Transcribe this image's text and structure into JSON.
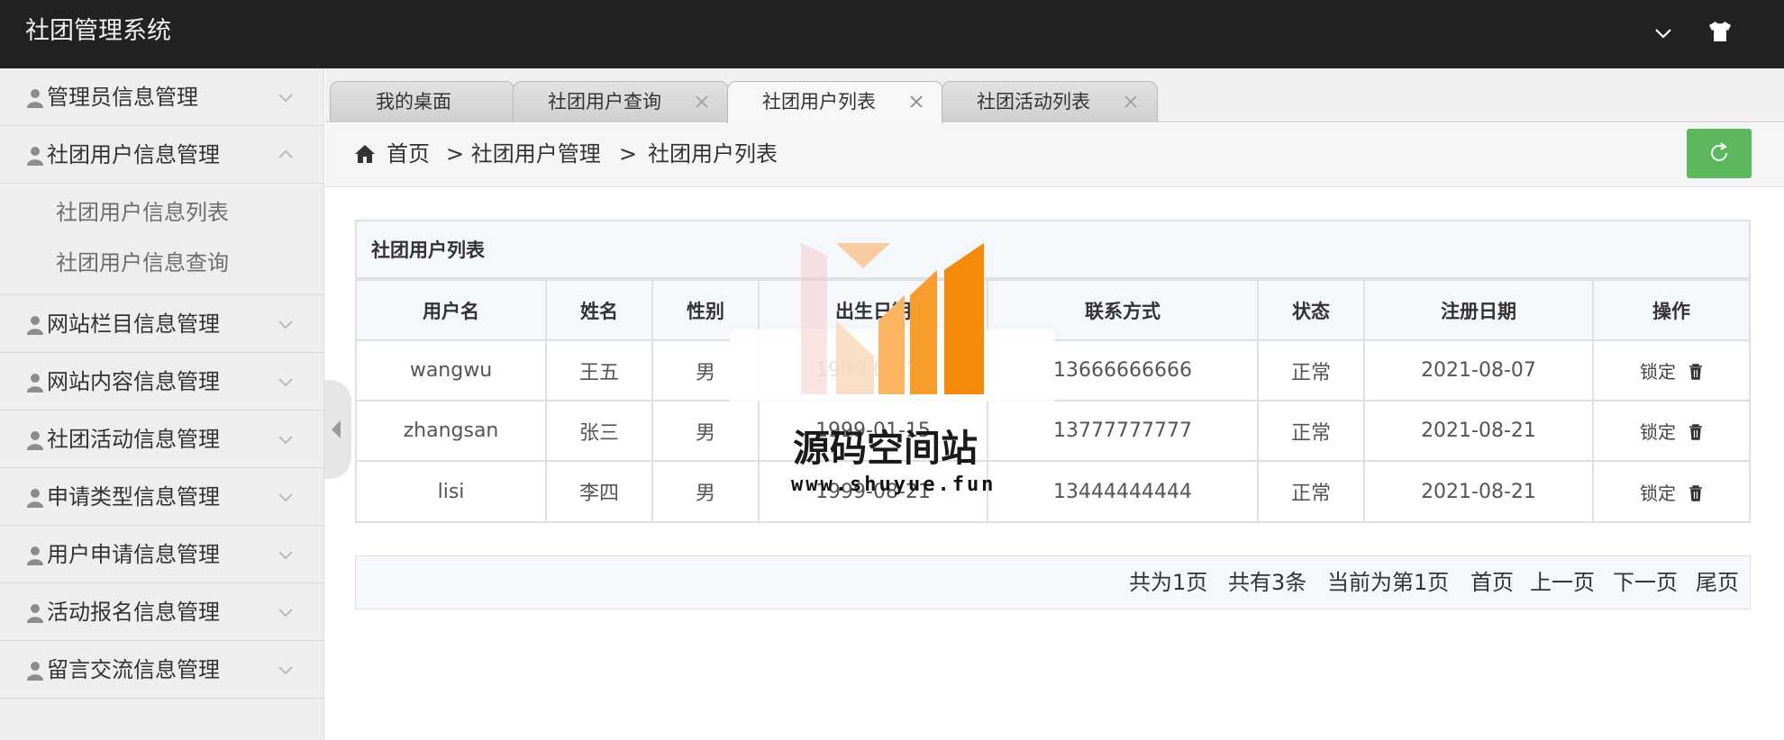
{
  "app": {
    "title": "社团管理系统"
  },
  "header": {
    "dropdown_icon": "chevron-down-icon",
    "theme_icon": "tshirt-icon"
  },
  "sidebar": {
    "items": [
      {
        "label": "管理员信息管理",
        "expanded": false
      },
      {
        "label": "社团用户信息管理",
        "expanded": true,
        "children": [
          "社团用户信息列表",
          "社团用户信息查询"
        ]
      },
      {
        "label": "网站栏目信息管理",
        "expanded": false
      },
      {
        "label": "网站内容信息管理",
        "expanded": false
      },
      {
        "label": "社团活动信息管理",
        "expanded": false
      },
      {
        "label": "申请类型信息管理",
        "expanded": false
      },
      {
        "label": "用户申请信息管理",
        "expanded": false
      },
      {
        "label": "活动报名信息管理",
        "expanded": false
      },
      {
        "label": "留言交流信息管理",
        "expanded": false
      }
    ]
  },
  "tabs": [
    {
      "label": "我的桌面",
      "closable": false,
      "active": false
    },
    {
      "label": "社团用户查询",
      "closable": true,
      "active": false
    },
    {
      "label": "社团用户列表",
      "closable": true,
      "active": true
    },
    {
      "label": "社团活动列表",
      "closable": true,
      "active": false
    }
  ],
  "breadcrumb": {
    "home": "首页",
    "level1": "> 社团用户管理",
    "separator": ">",
    "level2": "社团用户列表"
  },
  "colors": {
    "topbar": "#222222",
    "refresh_button": "#5cb85c",
    "table_header_bg": "#f4f7fc"
  },
  "table": {
    "title": "社团用户列表",
    "columns": [
      "用户名",
      "姓名",
      "性别",
      "出生日期",
      "联系方式",
      "状态",
      "注册日期",
      "操作"
    ],
    "rows": [
      {
        "username": "wangwu",
        "name": "王五",
        "gender": "男",
        "birth": "1999-01-15",
        "phone": "13666666666",
        "status": "正常",
        "reg_date": "2021-08-07",
        "action": "锁定"
      },
      {
        "username": "zhangsan",
        "name": "张三",
        "gender": "男",
        "birth": "1999-01-15",
        "phone": "13777777777",
        "status": "正常",
        "reg_date": "2021-08-21",
        "action": "锁定"
      },
      {
        "username": "lisi",
        "name": "李四",
        "gender": "男",
        "birth": "1999-08-21",
        "phone": "13444444444",
        "status": "正常",
        "reg_date": "2021-08-21",
        "action": "锁定"
      }
    ]
  },
  "pagination": {
    "total_pages": "共为1页",
    "total_records": "共有3条",
    "current": "当前为第1页",
    "first": "首页",
    "prev": "上一页",
    "next": "下一页",
    "last": "尾页"
  },
  "watermark": {
    "title": "源码空间站",
    "url": "www.shuyue.fun"
  }
}
